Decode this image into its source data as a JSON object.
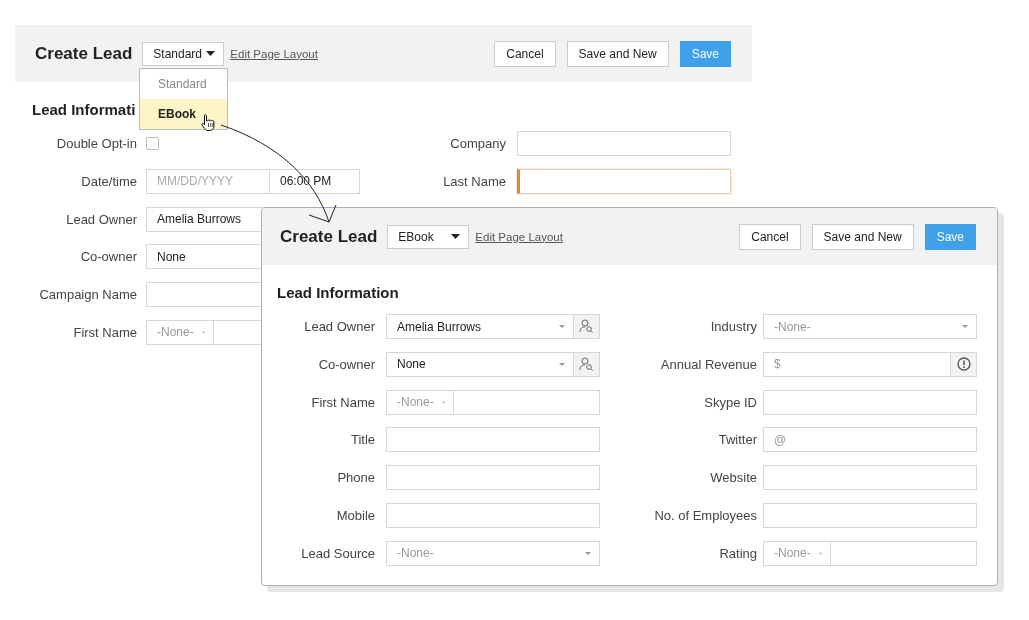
{
  "forms": [
    {
      "title": "Create Lead",
      "layout": "Standard",
      "link": "Edit Page Layout",
      "buttons": [
        {
          "label": "Cancel",
          "primary": false
        },
        {
          "label": "Save and New",
          "primary": false
        },
        {
          "label": "Save",
          "primary": true
        }
      ],
      "section": "Lead Informati",
      "left_fields": [
        {
          "label": "Double Opt-in",
          "kind": "checkbox",
          "checked": false
        },
        {
          "label": "Date/time",
          "kind": "datetime",
          "placeholder": "MM/DD/YYYY",
          "value": "06:00 PM",
          "focused": false
        },
        {
          "label": "Lead Owner",
          "kind": "lookup",
          "value": "Amelia Burrows"
        },
        {
          "label": "Co-owner",
          "kind": "lookup",
          "value": "None"
        },
        {
          "label": "Campaign Name",
          "kind": "text",
          "focused": false
        },
        {
          "label": "First Name",
          "kind": "split",
          "placeholder": "-None-",
          "focused": false
        }
      ],
      "right_fields": [
        {
          "label": "Company",
          "kind": "text",
          "focused": false
        },
        {
          "label": "Last Name",
          "kind": "text",
          "focused": true
        }
      ]
    },
    {
      "title": "Create Lead",
      "layout": "EBook",
      "link": "Edit Page Layout",
      "buttons": [
        {
          "label": "Cancel",
          "primary": false
        },
        {
          "label": "Save and New",
          "primary": false
        },
        {
          "label": "Save",
          "primary": true
        }
      ],
      "section": "Lead Information",
      "left_fields": [
        {
          "label": "Lead Owner",
          "kind": "lookup",
          "value": "Amelia Burrows"
        },
        {
          "label": "Co-owner",
          "kind": "lookup",
          "value": "None"
        },
        {
          "label": "First Name",
          "kind": "split",
          "placeholder": "-None-",
          "focused": false
        },
        {
          "label": "Title",
          "kind": "text",
          "focused": false
        },
        {
          "label": "Phone",
          "kind": "text",
          "focused": false
        },
        {
          "label": "Mobile",
          "kind": "text",
          "focused": false
        },
        {
          "label": "Lead Source",
          "kind": "select",
          "placeholder": "-None-"
        }
      ],
      "right_fields": [
        {
          "label": "Industry",
          "kind": "select",
          "placeholder": "-None-"
        },
        {
          "label": "Annual Revenue",
          "kind": "currency",
          "prefix": "$",
          "focused": false
        },
        {
          "label": "Skype ID",
          "kind": "text",
          "focused": false
        },
        {
          "label": "Twitter",
          "kind": "prefixed",
          "prefix": "@",
          "focused": false
        },
        {
          "label": "Website",
          "kind": "text",
          "focused": false
        },
        {
          "label": "No. of Employees",
          "kind": "text",
          "focused": false
        },
        {
          "label": "Rating",
          "kind": "split",
          "placeholder": "-None-",
          "focused": false
        }
      ]
    }
  ],
  "layout_menu": {
    "items": [
      {
        "label": "Standard",
        "selected": false
      },
      {
        "label": "EBook",
        "selected": true
      }
    ]
  }
}
